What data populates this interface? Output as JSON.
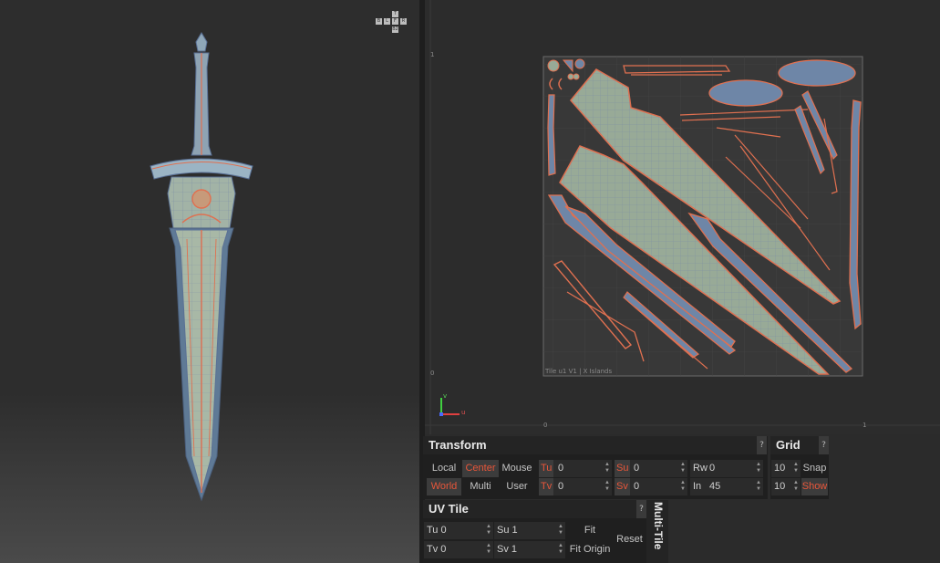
{
  "navcube": {
    "top": "T",
    "left": "B",
    "front": "L",
    "right": "F",
    "back": "R",
    "bottom": "B2"
  },
  "uv_editor": {
    "tile_info": "Tile u1 V1 | X Islands",
    "axis_v": "v",
    "axis_u": "u",
    "ruler_top_1": "1",
    "ruler_bottom_0": "0",
    "ruler_u_0": "0",
    "ruler_u_1": "1"
  },
  "transform": {
    "title": "Transform",
    "help": "?",
    "local": "Local",
    "center": "Center",
    "mouse": "Mouse",
    "world": "World",
    "multi": "Multi",
    "user": "User",
    "tu_label": "Tu",
    "tu_value": "0",
    "tv_label": "Tv",
    "tv_value": "0",
    "su_label": "Su",
    "su_value": "0",
    "sv_label": "Sv",
    "sv_value": "0",
    "rw_label": "Rw",
    "rw_value": "0",
    "in_label": "In",
    "in_value": "45"
  },
  "grid": {
    "title": "Grid",
    "help": "?",
    "value1": "10",
    "value2": "10",
    "snap": "Snap",
    "show": "Show"
  },
  "uv_tile": {
    "title": "UV Tile",
    "help": "?",
    "tu": "Tu 0",
    "tv": "Tv 0",
    "su": "Su 1",
    "sv": "Sv 1",
    "fit": "Fit",
    "fit_origin": "Fit Origin",
    "reset": "Reset",
    "multi_tile": "Multi-Tile"
  }
}
